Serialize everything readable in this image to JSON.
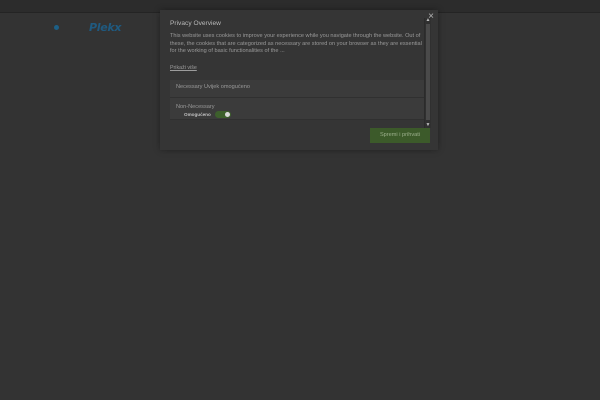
{
  "site": {
    "logo_text": "Plekx"
  },
  "modal": {
    "title": "Privacy Overview",
    "description": "This website uses cookies to improve your experience while you navigate through the website. Out of these, the cookies that are categorized as necessary are stored on your browser as they are essential for the working of basic functionalities of the ...",
    "read_more": "Prikaži više",
    "close_icon": "×",
    "accordion": [
      {
        "label": "Necessary Uvijek omogućeno"
      },
      {
        "label": "Non-Necessary",
        "sub_label": "Omogućeno",
        "enabled": true
      }
    ],
    "save_button": "Spremi i prihvati"
  },
  "colors": {
    "overlay": "#333333",
    "toggle_on": "#3d5f2c",
    "save_button": "#3c5a2a",
    "logo": "#1f5a80"
  }
}
